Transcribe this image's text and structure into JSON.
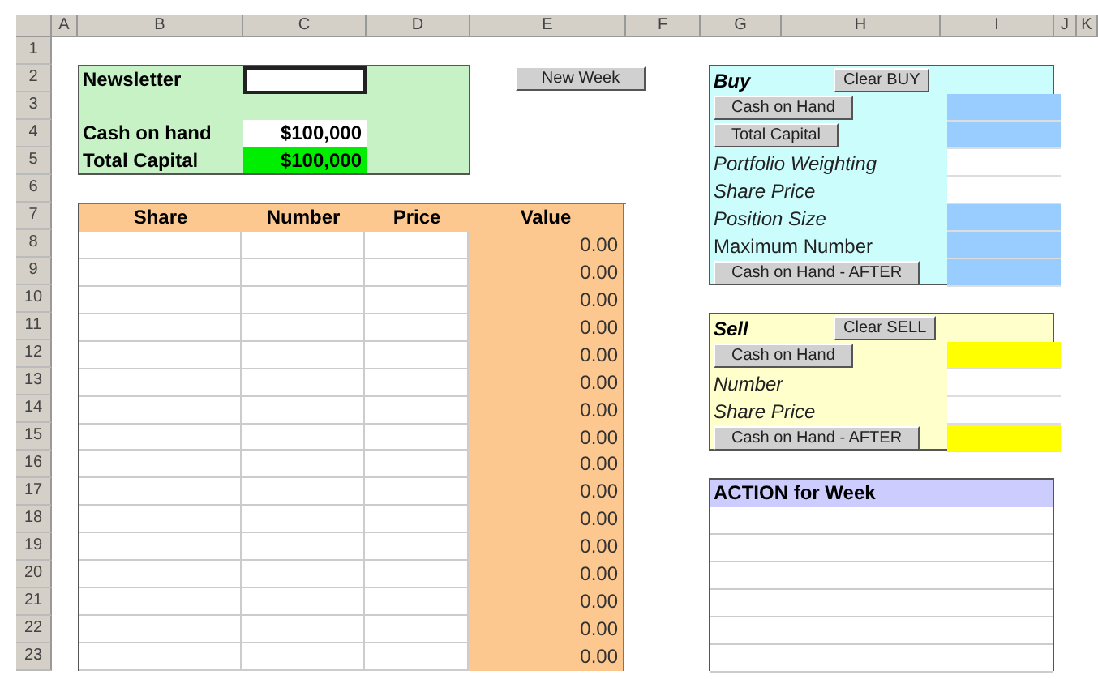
{
  "column_headers": [
    "A",
    "B",
    "C",
    "D",
    "E",
    "F",
    "G",
    "H",
    "I",
    "J",
    "K"
  ],
  "row_headers": [
    "1",
    "2",
    "3",
    "4",
    "5",
    "6",
    "7",
    "8",
    "9",
    "10",
    "11",
    "12",
    "13",
    "14",
    "15",
    "16",
    "17",
    "18",
    "19",
    "20",
    "21",
    "22",
    "23"
  ],
  "summary": {
    "newsletter_label": "Newsletter",
    "cash_label": "Cash on hand",
    "cash_value": "$100,000",
    "capital_label": "Total Capital",
    "capital_value": "$100,000"
  },
  "new_week_button": "New Week",
  "holdings": {
    "columns": [
      "Share",
      "Number",
      "Price",
      "Value"
    ],
    "rows": [
      {
        "value": "0.00"
      },
      {
        "value": "0.00"
      },
      {
        "value": "0.00"
      },
      {
        "value": "0.00"
      },
      {
        "value": "0.00"
      },
      {
        "value": "0.00"
      },
      {
        "value": "0.00"
      },
      {
        "value": "0.00"
      },
      {
        "value": "0.00"
      },
      {
        "value": "0.00"
      },
      {
        "value": "0.00"
      },
      {
        "value": "0.00"
      },
      {
        "value": "0.00"
      },
      {
        "value": "0.00"
      },
      {
        "value": "0.00"
      },
      {
        "value": "0.00"
      }
    ]
  },
  "buy": {
    "title": "Buy",
    "clear_button": "Clear BUY",
    "rows": [
      {
        "kind": "button",
        "label": "Cash on Hand",
        "color": "#99ccff"
      },
      {
        "kind": "button",
        "label": "Total Capital",
        "color": "#99ccff"
      },
      {
        "kind": "label",
        "label": "Portfolio Weighting",
        "italic": true,
        "color": "#ffffff"
      },
      {
        "kind": "label",
        "label": "Share Price",
        "italic": true,
        "color": "#ffffff"
      },
      {
        "kind": "label",
        "label": "Position Size",
        "italic": true,
        "color": "#99ccff"
      },
      {
        "kind": "label",
        "label": "Maximum Number",
        "italic": false,
        "color": "#99ccff"
      },
      {
        "kind": "button",
        "label": "Cash on Hand - AFTER",
        "color": "#99ccff"
      }
    ]
  },
  "sell": {
    "title": "Sell",
    "clear_button": "Clear SELL",
    "rows": [
      {
        "kind": "button",
        "label": "Cash on Hand",
        "color": "#ffff00"
      },
      {
        "kind": "label",
        "label": "Number",
        "italic": true,
        "color": "#ffffff"
      },
      {
        "kind": "label",
        "label": "Share Price",
        "italic": true,
        "color": "#ffffff"
      },
      {
        "kind": "button",
        "label": "Cash on Hand - AFTER",
        "color": "#ffff00"
      }
    ]
  },
  "action": {
    "title": "ACTION for Week"
  }
}
